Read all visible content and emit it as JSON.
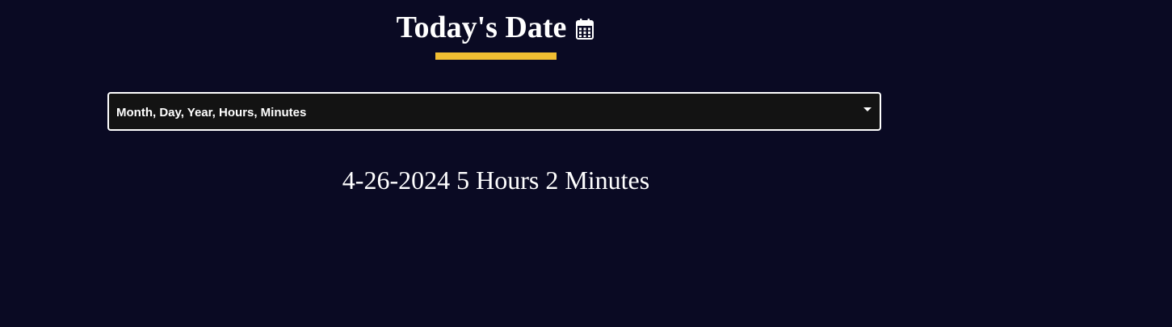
{
  "header": {
    "title": "Today's Date",
    "icon": "calendar-icon",
    "accent_color": "#f1be32"
  },
  "date_format_select": {
    "selected_value": "Month, Day, Year, Hours, Minutes"
  },
  "current_date_output": "4-26-2024 5 Hours 2 Minutes",
  "colors": {
    "background": "#0a0a23",
    "select_background": "#131313",
    "text": "#ffffff"
  }
}
